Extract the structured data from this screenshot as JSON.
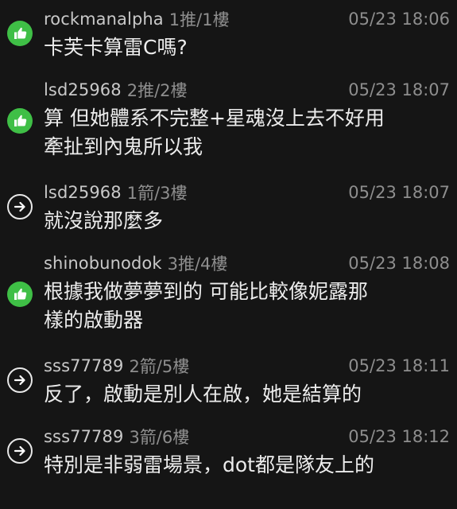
{
  "comments": [
    {
      "user": "rockmanalpha",
      "floor": "1推/1樓",
      "time": "05/23 18:06",
      "icon": "thumbs-up-icon",
      "lines": [
        "卡芙卡算雷C嗎?"
      ]
    },
    {
      "user": "lsd25968",
      "floor": "2推/2樓",
      "time": "05/23 18:07",
      "icon": "thumbs-up-icon",
      "lines": [
        "算 但她體系不完整+星魂沒上去不好用",
        "牽扯到內鬼所以我"
      ]
    },
    {
      "user": "lsd25968",
      "floor": "1箭/3樓",
      "time": "05/23 18:07",
      "icon": "arrow-right-icon",
      "lines": [
        "就沒說那麼多"
      ]
    },
    {
      "user": "shinobunodok",
      "floor": "3推/4樓",
      "time": "05/23 18:08",
      "icon": "thumbs-up-icon",
      "lines": [
        "根據我做夢夢到的 可能比較像妮露那",
        "樣的啟動器"
      ]
    },
    {
      "user": "sss77789",
      "floor": "2箭/5樓",
      "time": "05/23 18:11",
      "icon": "arrow-right-icon",
      "lines": [
        "反了，啟動是別人在啟，她是結算的"
      ]
    },
    {
      "user": "sss77789",
      "floor": "3箭/6樓",
      "time": "05/23 18:12",
      "icon": "arrow-right-icon",
      "lines": [
        "特別是非弱雷場景，dot都是隊友上的"
      ]
    }
  ],
  "colors": {
    "push": "#3fbf46",
    "background": "#151515"
  }
}
